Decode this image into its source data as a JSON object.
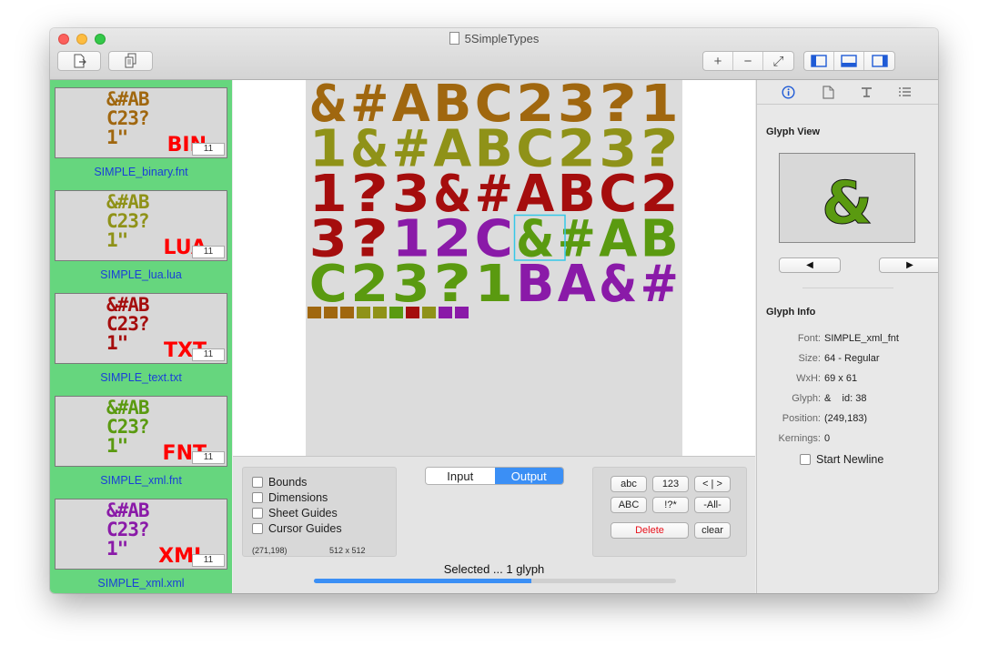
{
  "window": {
    "title": "5SimpleTypes"
  },
  "toolbar": {
    "left_buttons": [
      {
        "icon": "export-doc-icon"
      },
      {
        "icon": "duplicate-doc-icon"
      }
    ],
    "zoom": [
      "+",
      "−",
      "⤢"
    ],
    "view_toggles": [
      "left-panel-icon",
      "bottom-panel-icon",
      "right-panel-icon"
    ]
  },
  "sidebar": {
    "items": [
      {
        "glyph_lines": [
          "&#AB",
          "C23?",
          "1\""
        ],
        "tag": "BIN",
        "count": "11",
        "filename": "SIMPLE_binary.fnt",
        "color": "#a0670f"
      },
      {
        "glyph_lines": [
          "&#AB",
          "C23?",
          "1\""
        ],
        "tag": "LUA",
        "count": "11",
        "filename": "SIMPLE_lua.lua",
        "color": "#8f9218"
      },
      {
        "glyph_lines": [
          "&#AB",
          "C23?",
          "1\""
        ],
        "tag": "TXT",
        "count": "11",
        "filename": "SIMPLE_text.txt",
        "color": "#a50d0d"
      },
      {
        "glyph_lines": [
          "&#AB",
          "C23?",
          "1\""
        ],
        "tag": "FNT",
        "count": "11",
        "filename": "SIMPLE_xml.fnt",
        "color": "#5a9a10"
      },
      {
        "glyph_lines": [
          "&#AB",
          "C23?",
          "1\""
        ],
        "tag": "XML",
        "count": "11",
        "filename": "SIMPLE_xml.xml",
        "color": "#8a1aa8"
      }
    ]
  },
  "sheet": {
    "rows": [
      {
        "text": "&#ABC23?1",
        "color": "#a0670f"
      },
      {
        "text": "1&#ABC23?",
        "color": "#8f9218"
      },
      {
        "text": "1?3&#ABC2",
        "color": "#a50d0d"
      },
      {
        "text": "3?12C&#AB",
        "colors": [
          "#a50d0d",
          "#a50d0d",
          "#8a1aa8",
          "#8a1aa8",
          "#8a1aa8",
          "#5a9a10",
          "#5a9a10",
          "#5a9a10",
          "#5a9a10"
        ]
      },
      {
        "text": "C23?1BA&#",
        "colors": [
          "#5a9a10",
          "#5a9a10",
          "#5a9a10",
          "#5a9a10",
          "#5a9a10",
          "#8a1aa8",
          "#8a1aa8",
          "#8a1aa8",
          "#8a1aa8"
        ]
      }
    ],
    "small_blocks": [
      "#a0670f",
      "#a0670f",
      "#a0670f",
      "#8f9218",
      "#8f9218",
      "#5a9a10",
      "#a50d0d",
      "#8f9218",
      "#8a1aa8",
      "#8a1aa8"
    ],
    "selection_color": "#35c8e8"
  },
  "options": {
    "checkboxes": [
      {
        "label": "Bounds",
        "checked": false
      },
      {
        "label": "Dimensions",
        "checked": false
      },
      {
        "label": "Sheet Guides",
        "checked": false
      },
      {
        "label": "Cursor Guides",
        "checked": false
      }
    ],
    "cursor_pos": "(271,198)",
    "sheet_size": "512 x 512"
  },
  "mode": {
    "input_label": "Input",
    "output_label": "Output",
    "selected": "Output"
  },
  "char_buttons": {
    "row1": [
      "abc",
      "123",
      "< | >"
    ],
    "row2": [
      "ABC",
      "!?*",
      "-All-"
    ],
    "delete_label": "Delete",
    "clear_label": "clear"
  },
  "status": {
    "text": "Selected ... 1 glyph",
    "progress": 0.6
  },
  "inspector": {
    "tabs": [
      "info-icon",
      "document-icon",
      "text-format-icon",
      "list-icon"
    ],
    "glyph_view_title": "Glyph View",
    "glyph": "&",
    "glyph_color": "#5a9a10",
    "prev_label": "◀",
    "next_label": "▶",
    "glyph_info_title": "Glyph Info",
    "info": [
      {
        "label": "Font:",
        "value": "SIMPLE_xml_fnt"
      },
      {
        "label": "Size:",
        "value": "64 - Regular"
      },
      {
        "label": "WxH:",
        "value": "69 x 61"
      },
      {
        "label": "Glyph:",
        "value": "&    id: 38"
      },
      {
        "label": "Position:",
        "value": "(249,183)"
      },
      {
        "label": "Kernings:",
        "value": "0"
      }
    ],
    "start_newline_label": "Start Newline"
  }
}
